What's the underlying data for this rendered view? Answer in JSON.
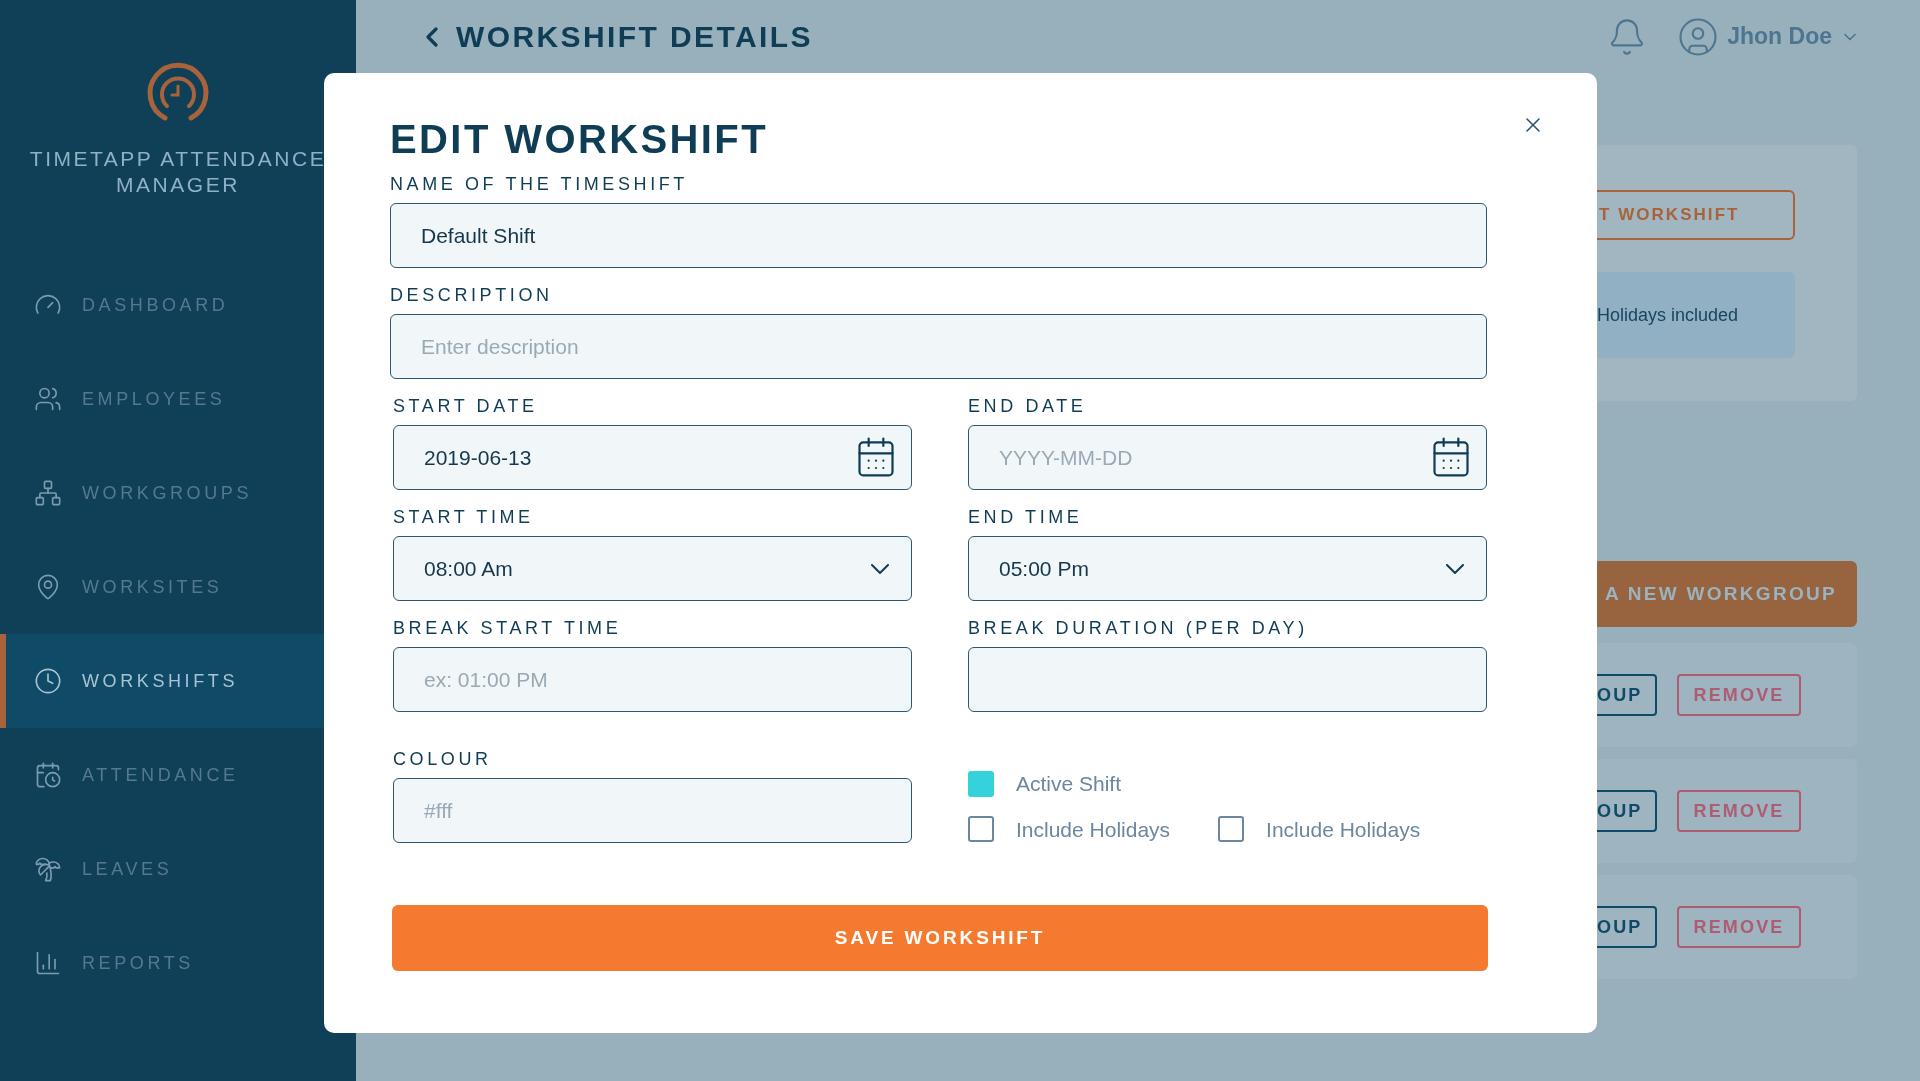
{
  "sidebar": {
    "app_title": "TIMETAPP ATTENDANCE MANAGER",
    "nav": [
      {
        "label": "DASHBOARD",
        "selected": false
      },
      {
        "label": "EMPLOYEES",
        "selected": false
      },
      {
        "label": "WORKGROUPS",
        "selected": false
      },
      {
        "label": "WORKSITES",
        "selected": false
      },
      {
        "label": "WORKSHIFTS",
        "selected": true
      },
      {
        "label": "ATTENDANCE",
        "selected": false
      },
      {
        "label": "LEAVES",
        "selected": false
      },
      {
        "label": "REPORTS",
        "selected": false
      }
    ]
  },
  "header": {
    "title": "WORKSHIFT DETAILS",
    "user": "Jhon Doe"
  },
  "background": {
    "edit_button": "T WORKSHIFT",
    "info": "Holidays included",
    "add_button": "A NEW WORKGROUP",
    "rows": [
      {
        "group_button": "OUP",
        "remove_button": "REMOVE"
      },
      {
        "group_button": "OUP",
        "remove_button": "REMOVE"
      },
      {
        "group_button": "OUP",
        "remove_button": "REMOVE"
      }
    ]
  },
  "modal": {
    "title": "EDIT WORKSHIFT",
    "name": {
      "label": "NAME OF THE TIMESHIFT",
      "value": "Default Shift"
    },
    "description": {
      "label": "DESCRIPTION",
      "placeholder": "Enter description"
    },
    "start_date": {
      "label": "START DATE",
      "value": "2019-06-13"
    },
    "end_date": {
      "label": "END DATE",
      "placeholder": "YYYY-MM-DD"
    },
    "start_time": {
      "label": "START TIME",
      "value": "08:00 Am"
    },
    "end_time": {
      "label": "END TIME",
      "value": "05:00 Pm"
    },
    "break_start": {
      "label": "BREAK START TIME",
      "placeholder": "ex: 01:00 PM"
    },
    "break_duration": {
      "label": "BREAK DURATION (PER DAY)"
    },
    "colour": {
      "label": "COLOUR",
      "placeholder": "#fff"
    },
    "checkboxes": [
      {
        "label": "Active Shift",
        "checked": true
      },
      {
        "label": "Include Holidays",
        "checked": false
      },
      {
        "label": "Include Holidays",
        "checked": false
      }
    ],
    "save_button": "SAVE WORKSHIFT"
  }
}
